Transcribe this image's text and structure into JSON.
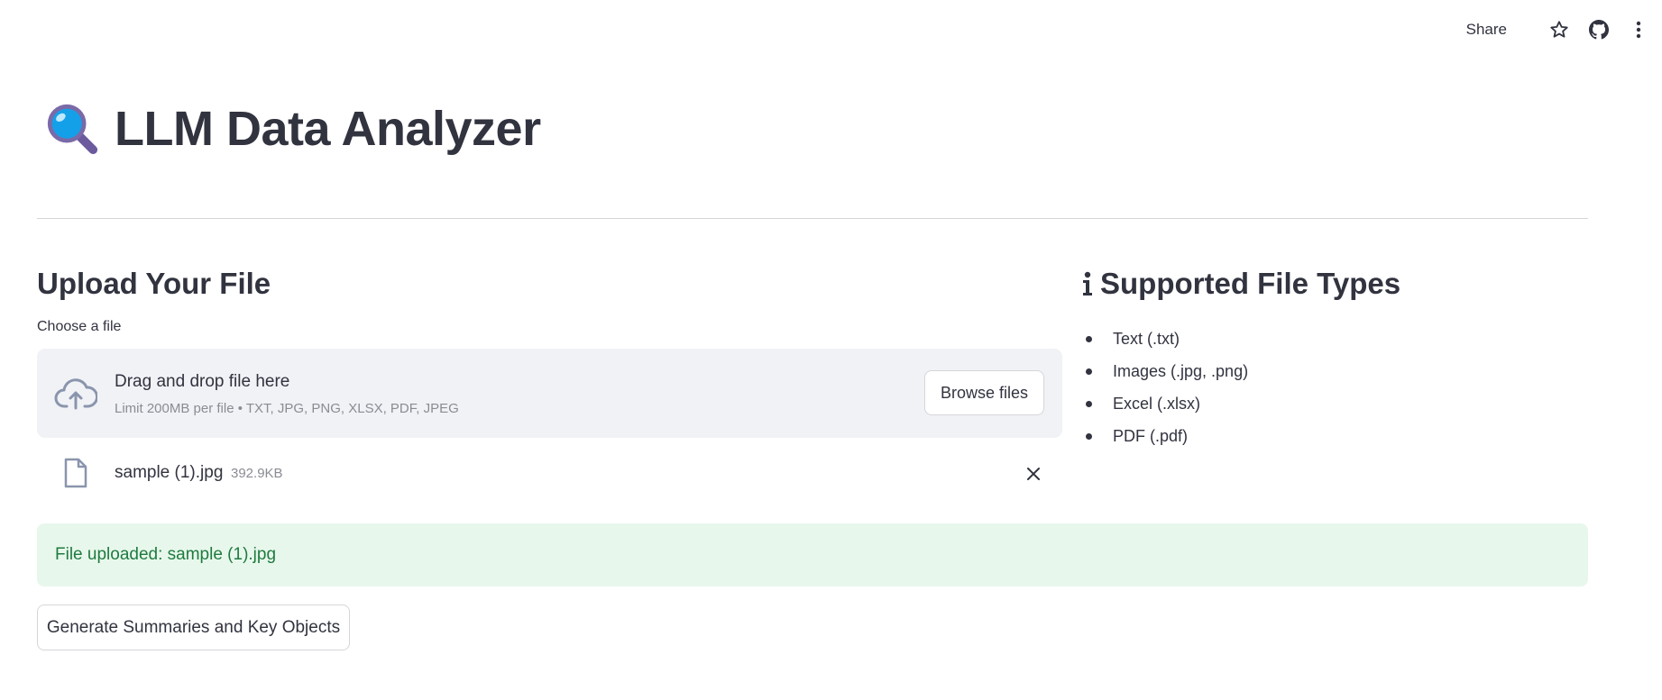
{
  "toolbar": {
    "share_label": "Share",
    "icons": [
      "star-icon",
      "github-icon",
      "more-vertical-icon"
    ]
  },
  "header": {
    "emoji": "magnifying-glass-icon",
    "title": "LLM Data Analyzer"
  },
  "upload": {
    "heading": "Upload Your File",
    "choose_label": "Choose a file",
    "dropzone_title": "Drag and drop file here",
    "dropzone_limit": "Limit 200MB per file • TXT, JPG, PNG, XLSX, PDF, JPEG",
    "browse_label": "Browse files",
    "file": {
      "name": "sample (1).jpg",
      "size": "392.9KB"
    }
  },
  "supported": {
    "heading": "Supported File Types",
    "items": [
      "Text (.txt)",
      "Images (.jpg, .png)",
      "Excel (.xlsx)",
      "PDF (.pdf)"
    ]
  },
  "status": {
    "success_text": "File uploaded: sample (1).jpg"
  },
  "actions": {
    "generate_label": "Generate Summaries and Key Objects"
  },
  "colors": {
    "text": "#31333f",
    "dropzone_bg": "#f0f2f6",
    "success_bg": "#e8f7ec",
    "success_text": "#1e7b3f",
    "muted": "#8a8c94"
  }
}
